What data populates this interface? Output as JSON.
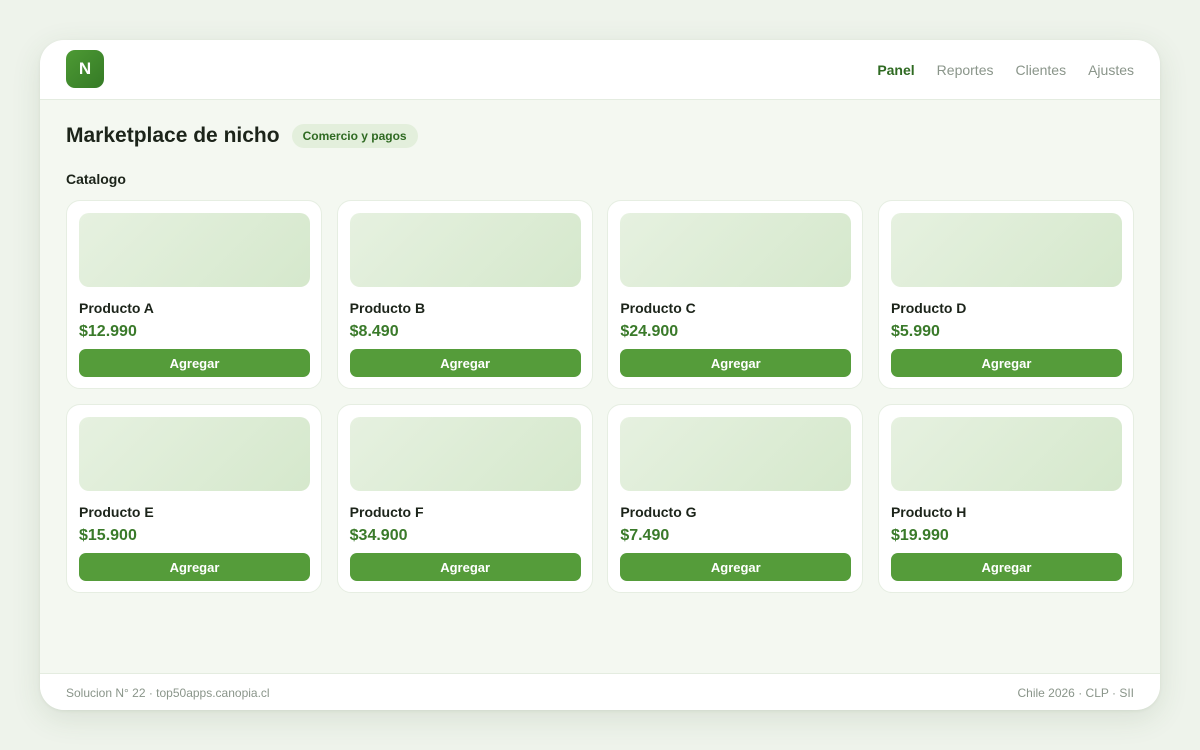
{
  "header": {
    "logo_letter": "N",
    "nav": [
      {
        "label": "Panel",
        "active": true
      },
      {
        "label": "Reportes",
        "active": false
      },
      {
        "label": "Clientes",
        "active": false
      },
      {
        "label": "Ajustes",
        "active": false
      }
    ]
  },
  "page": {
    "title": "Marketplace de nicho",
    "badge": "Comercio y pagos",
    "section_title": "Catalogo"
  },
  "products": [
    {
      "name": "Producto A",
      "price": "$12.990",
      "button": "Agregar"
    },
    {
      "name": "Producto B",
      "price": "$8.490",
      "button": "Agregar"
    },
    {
      "name": "Producto C",
      "price": "$24.900",
      "button": "Agregar"
    },
    {
      "name": "Producto D",
      "price": "$5.990",
      "button": "Agregar"
    },
    {
      "name": "Producto E",
      "price": "$15.900",
      "button": "Agregar"
    },
    {
      "name": "Producto F",
      "price": "$34.900",
      "button": "Agregar"
    },
    {
      "name": "Producto G",
      "price": "$7.490",
      "button": "Agregar"
    },
    {
      "name": "Producto H",
      "price": "$19.990",
      "button": "Agregar"
    }
  ],
  "footer": {
    "left": "Solucion N° 22 · top50apps.canopia.cl",
    "right": "Chile 2026 · CLP · SII"
  },
  "colors": {
    "accent": "#559c3a",
    "accent_dark": "#2f6a22",
    "background": "#f4f8f1"
  }
}
